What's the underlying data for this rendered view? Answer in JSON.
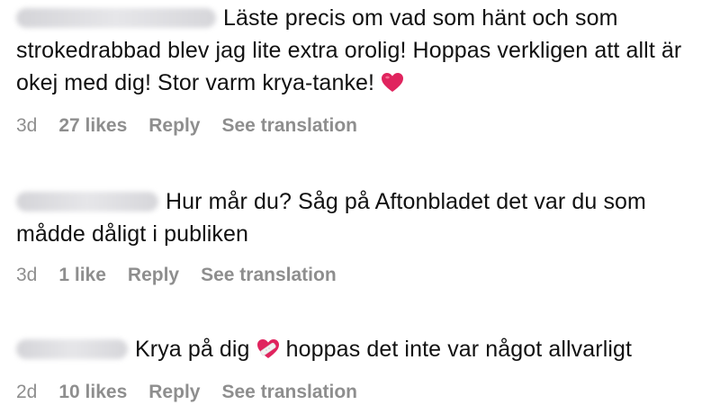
{
  "comments": [
    {
      "username": "blurred-user-1",
      "text": "Läste precis om vad som hänt och som strokedrabbad blev jag lite extra orolig! Hoppas verkligen att allt är okej med dig! Stor varm krya-tanke!",
      "text_after_icon": "",
      "icon": "red-heart-icon",
      "age": "3d",
      "likes": "27 likes",
      "reply": "Reply",
      "translation": "See translation"
    },
    {
      "username": "blurred-user-2",
      "text": "Hur mår du? Såg på Aftonbladet det var du som mådde dåligt i publiken",
      "age": "3d",
      "likes": "1 like",
      "reply": "Reply",
      "translation": "See translation"
    },
    {
      "username": "blurred-user-3",
      "text": "Krya på dig",
      "icon": "mending-heart-icon",
      "text_after_icon": "hoppas det inte var något allvarligt",
      "age": "2d",
      "likes": "10 likes",
      "reply": "Reply",
      "translation": "See translation"
    }
  ],
  "colors": {
    "text": "#111111",
    "meta": "#8e8e8e",
    "heart": "#e0245e"
  }
}
